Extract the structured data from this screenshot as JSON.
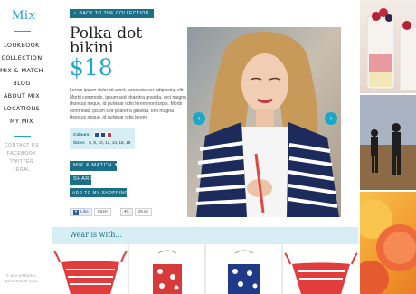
{
  "brand": {
    "logo_text": "Mix"
  },
  "sidebar": {
    "nav": [
      {
        "label": "LOOKBOOK"
      },
      {
        "label": "COLLECTION"
      },
      {
        "label": "MIX & MATCH"
      },
      {
        "label": "BLOG"
      },
      {
        "label": "ABOUT MIX"
      },
      {
        "label": "LOCATIONS"
      },
      {
        "label": "MY MIX"
      }
    ],
    "secondary": [
      {
        "label": "CONTACT US"
      },
      {
        "label": "FACEBOOK"
      },
      {
        "label": "TWITTER"
      },
      {
        "label": "LEGAL"
      }
    ],
    "copyright_line1": "© MIX APPAREL",
    "copyright_line2": "AUSTRALIA 2011"
  },
  "product": {
    "back_label": "BACK TO THE COLLECTION",
    "title": "Polka dot bikini",
    "price": "$18",
    "description": "Lorem ipsum dolor sit amet, consectetuer adipiscing elit. Morbi commodo, ipsum sed pharetra gravida, orci magna rhoncus neque, id pulvinar odio lorem non turpis. Morbi commodo, ipsum sed pharetra gravida, orci magna rhoncus neque, id pulvinar odio lorem.",
    "colours_label": "Colours:",
    "colours": [
      "#1f4fa0",
      "#2d3f8c",
      "#d8323a"
    ],
    "sizes_label": "Sizes:",
    "sizes": "6, 8, 10, 12, 14, 16, 18",
    "mixmatch_label": "MIX & MATCH",
    "share_label": "SHARE",
    "add_list_label": "ADD TO MY SHOPPING LIST"
  },
  "social": {
    "like_label": "Like",
    "like_count": "564K",
    "plus_label": "+1",
    "plus_count": "29.6k"
  },
  "gallery": {
    "prev_icon": "‹",
    "next_icon": "›"
  },
  "wear_with": {
    "title": "Wear is with..."
  }
}
